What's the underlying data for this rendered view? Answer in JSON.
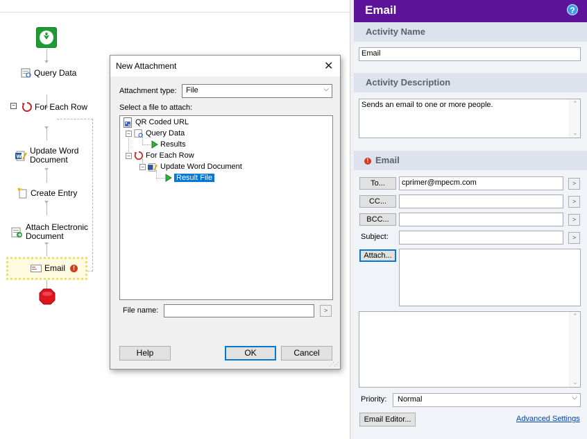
{
  "workflow": {
    "nodes": [
      {
        "label": "Query Data"
      },
      {
        "label": "For Each Row"
      },
      {
        "label": "Update Word\nDocument"
      },
      {
        "label": "Create Entry"
      },
      {
        "label": "Attach Electronic\nDocument"
      },
      {
        "label": "Email"
      }
    ],
    "loop_toggle": "⊟",
    "warning_badge": "!",
    "colors": {
      "start": "#1e9b35",
      "stop": "#e0141e",
      "selection": "#f3e24a",
      "connector": "#b5b5b5"
    }
  },
  "dialog": {
    "title": "New Attachment",
    "close_glyph": "✕",
    "attachment_type_label": "Attachment type:",
    "attachment_type_value": "File",
    "select_label": "Select a file to attach:",
    "tree": {
      "root": "QR Coded URL",
      "query": "Query Data",
      "query_child": "Results",
      "loop": "For Each Row",
      "loop_child": "Update Word Document",
      "selected": "Result File",
      "expander": "−"
    },
    "file_name_label": "File name:",
    "file_name_value": "",
    "browse": ">",
    "help": "Help",
    "ok": "OK",
    "cancel": "Cancel"
  },
  "panel": {
    "title": "Email",
    "help_glyph": "?",
    "activity_name_head": "Activity Name",
    "activity_name": "Email",
    "activity_desc_head": "Activity Description",
    "activity_desc": "Sends an email to one or more people.",
    "email_head": "Email",
    "to_btn": "To...",
    "to_value": "cprimer@mpecm.com",
    "cc_btn": "CC...",
    "cc_value": "",
    "bcc_btn": "BCC...",
    "bcc_value": "",
    "subject_label": "Subject:",
    "subject_value": "",
    "attach_btn": "Attach...",
    "body_value": "",
    "priority_label": "Priority:",
    "priority_value": "Normal",
    "editor_btn": "Email Editor...",
    "advanced_link": "Advanced Settings",
    "arrow": ">",
    "colors": {
      "header": "#5c139a",
      "section": "#dde3ec",
      "warning": "#d9391b"
    }
  }
}
